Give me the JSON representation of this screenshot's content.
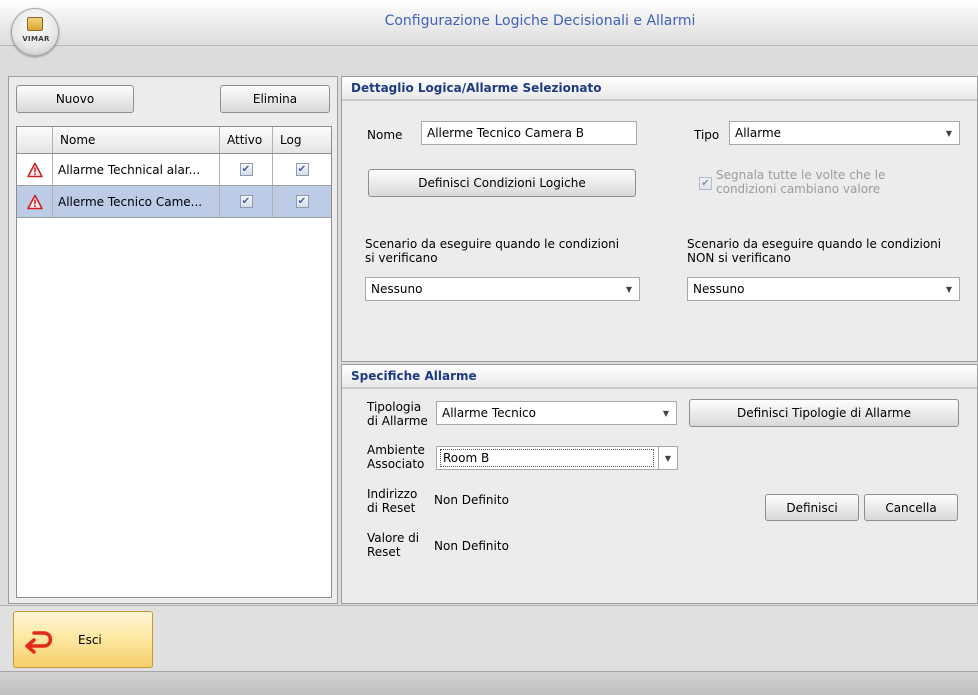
{
  "window": {
    "title": "Configurazione Logiche Decisionali e Allarmi",
    "logo_text": "VIMAR"
  },
  "left": {
    "new_button": "Nuovo",
    "delete_button": "Elimina",
    "columns": [
      "Nome",
      "Attivo",
      "Log"
    ],
    "rows": [
      {
        "name": "Allarme Technical alar...",
        "active": true,
        "log": true,
        "icon": "warning-icon"
      },
      {
        "name": "Allerme Tecnico Came...",
        "active": true,
        "log": true,
        "icon": "warning-icon",
        "selected": true
      }
    ]
  },
  "detail": {
    "header": "Dettaglio Logica/Allarme Selezionato",
    "name_label": "Nome",
    "name_value": "Allerme Tecnico Camera B",
    "type_label": "Tipo",
    "type_value": "Allarme",
    "define_conditions_button": "Definisci Condizioni Logiche",
    "signal_checkbox_line1": "Segnala tutte le volte che le",
    "signal_checkbox_line2": "condizioni cambiano valore",
    "signal_checked": true,
    "scenario_true_line1": "Scenario da eseguire quando le condizioni",
    "scenario_true_line2": "si verificano",
    "scenario_true_value": "Nessuno",
    "scenario_false_line1": "Scenario da eseguire quando le condizioni",
    "scenario_false_line2": "NON si verificano",
    "scenario_false_value": "Nessuno"
  },
  "alarm": {
    "header": "Specifiche Allarme",
    "type_label_line1": "Tipologia",
    "type_label_line2": "di Allarme",
    "type_value": "Allarme Tecnico",
    "define_types_button": "Definisci Tipologie di Allarme",
    "room_label_line1": "Ambiente",
    "room_label_line2": "Associato",
    "room_value": "Room B",
    "reset_addr_label_line1": "Indirizzo",
    "reset_addr_label_line2": "di Reset",
    "reset_addr_value": "Non Definito",
    "reset_val_label_line1": "Valore di",
    "reset_val_label_line2": "Reset",
    "reset_val_value": "Non Definito",
    "define_button": "Definisci",
    "cancel_button": "Cancella"
  },
  "footer": {
    "exit_button": "Esci"
  },
  "colors": {
    "title": "#3f63b8",
    "section_header": "#1d3b82",
    "selected_row": "#bccbe6",
    "warning": "#cc2020",
    "exit_button": "#fde9a4"
  }
}
